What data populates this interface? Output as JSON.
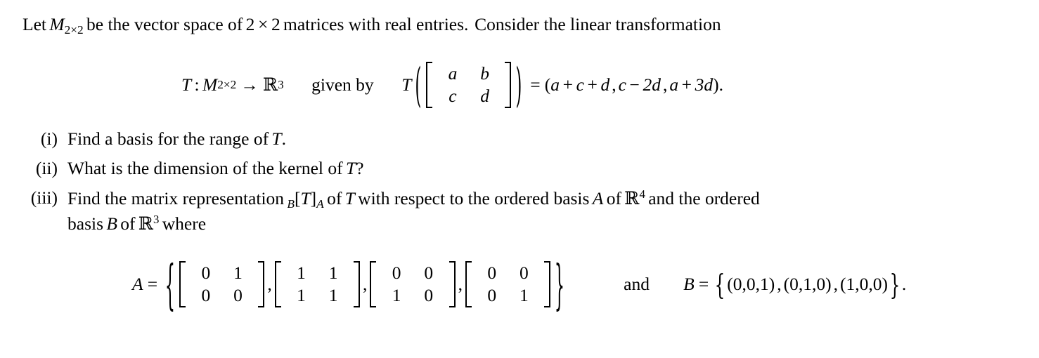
{
  "document": {
    "type": "math-problem",
    "subject": "linear-algebra",
    "background_color": "#ffffff",
    "text_color": "#000000"
  },
  "intro": {
    "part1": "Let",
    "matrix_space": "M",
    "matrix_space_sub": "2×2",
    "part2": "be the vector space of",
    "dim_a": "2",
    "times": "×",
    "dim_b": "2",
    "part3": "matrices with real entries.",
    "part4": "Consider the linear transformation"
  },
  "display_equation": {
    "map_name": "T",
    "colon": ":",
    "domain": "M",
    "domain_sub": "2×2",
    "arrow": "→",
    "codomain": "ℝ",
    "codomain_exp": "3",
    "given_by": "given by",
    "applied_name": "T",
    "argument_matrix": {
      "rows": [
        [
          "a",
          "b"
        ],
        [
          "c",
          "d"
        ]
      ]
    },
    "equals": "=",
    "result": {
      "open": "(",
      "components": [
        {
          "terms": [
            {
              "sign": "",
              "value": "a"
            },
            {
              "sign": "+",
              "value": "c"
            },
            {
              "sign": "+",
              "value": "d"
            }
          ]
        },
        {
          "terms": [
            {
              "sign": "",
              "value": "c"
            },
            {
              "sign": "−",
              "value": "2d"
            }
          ]
        },
        {
          "terms": [
            {
              "sign": "",
              "value": "a"
            },
            {
              "sign": "+",
              "value": "3d"
            }
          ]
        }
      ],
      "close": ")",
      "period": "."
    }
  },
  "items": [
    {
      "label": "(i)",
      "line1_a": "Find a basis for the range of",
      "line1_var": "T",
      "line1_b": ".",
      "line2": ""
    },
    {
      "label": "(ii)",
      "line1_a": "What is the dimension of the kernel of",
      "line1_var": "T",
      "line1_b": "?",
      "line2": ""
    },
    {
      "label": "(iii)",
      "line1_a": "Find the matrix representation",
      "matrix_rep": {
        "left_sub": "B",
        "open": "[",
        "body": "T",
        "close": "]",
        "right_sub": "A"
      },
      "line1_b": "of",
      "line1_var": "T",
      "line1_c": "with respect to the ordered basis",
      "basis_a": "A",
      "line1_d": "of",
      "space_a": "ℝ",
      "space_a_exp": "4",
      "line1_e": "and the ordered",
      "line2_a": "basis",
      "basis_b": "B",
      "line2_b": "of",
      "space_b": "ℝ",
      "space_b_exp": "3",
      "line2_c": "where"
    }
  ],
  "basis_display": {
    "set_a": {
      "name": "A",
      "equals": "=",
      "open_brace": "{",
      "matrices": [
        {
          "rows": [
            [
              "0",
              "1"
            ],
            [
              "0",
              "0"
            ]
          ]
        },
        {
          "rows": [
            [
              "1",
              "1"
            ],
            [
              "1",
              "1"
            ]
          ]
        },
        {
          "rows": [
            [
              "0",
              "0"
            ],
            [
              "1",
              "0"
            ]
          ]
        },
        {
          "rows": [
            [
              "0",
              "0"
            ],
            [
              "0",
              "1"
            ]
          ]
        }
      ],
      "separator": ",",
      "close_brace": "}"
    },
    "conjunction": "and",
    "set_b": {
      "name": "B",
      "equals": "=",
      "open_brace": "{",
      "vectors": [
        [
          "0",
          "0",
          "1"
        ],
        [
          "0",
          "1",
          "0"
        ],
        [
          "1",
          "0",
          "0"
        ]
      ],
      "separator": ",",
      "close_brace": "}",
      "period": "."
    }
  }
}
